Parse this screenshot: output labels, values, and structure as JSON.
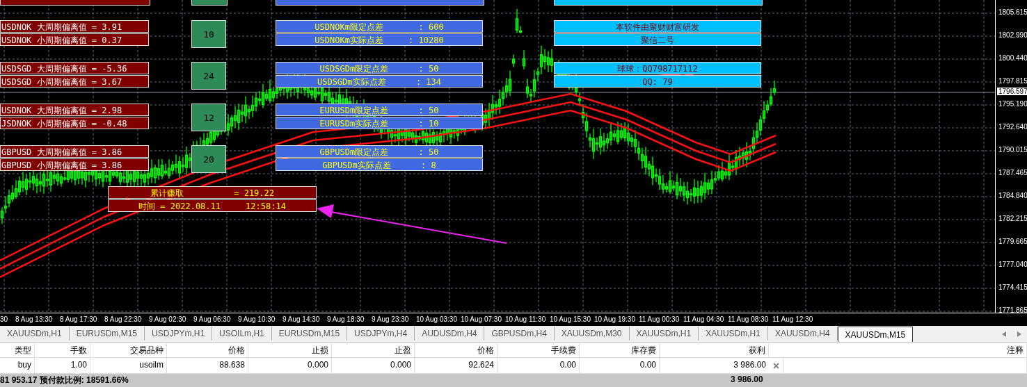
{
  "monitor_groups": [
    {
      "deviation": [
        "USDNOK 大周期偏离值 = 3.91",
        "USDNOK 小周期偏离值 = 0.37"
      ],
      "count": "10",
      "spread": [
        "USDNOKm限定点差       : 600",
        "USDNOKm实际点差     : 10280"
      ]
    },
    {
      "deviation": [
        "USDSGD 大周期偏离值 = -5.36",
        "USDSGD 小周期偏离值 = 3.67"
      ],
      "count": "24",
      "spread": [
        "USDSGDm限定点差      : 50",
        "USDSGDm实际点差      : 134"
      ]
    },
    {
      "deviation": [
        "USDNOK 大周期偏离值 = 2.98",
        "JSDNOK 小周期偏离值 = -0.48"
      ],
      "count": "12",
      "spread": [
        "EURUSDm限定点差      : 50",
        "EURUSDm实际点差      : 10"
      ]
    },
    {
      "deviation": [
        "GBPUSD 大周期偏离值 = 3.86",
        "GBPUSD 小周期偏离值 = 3.86"
      ],
      "count": "20",
      "spread": [
        "GBPUSDm限定点差      : 50",
        "GBPUSDm实际点差      : 8"
      ]
    }
  ],
  "info_lines": [
    "本软件由聚财财富研发",
    "聚信二号",
    "球球：QQ798717112",
    "QQ: 79"
  ],
  "profit_panel": [
    "累计赚取          = 219.22",
    "时间 = 2022.08.11     12:58:14"
  ],
  "price_axis": {
    "labels": [
      "1805.615",
      "1802.990",
      "1800.440",
      "1797.815",
      "1795.190",
      "1792.640",
      "1790.015",
      "1787.465",
      "1784.840",
      "1782.215",
      "1779.665",
      "1777.040",
      "1774.415",
      "1771.865"
    ],
    "current_price": "1796.597"
  },
  "time_axis": [
    "30",
    "8 Aug 13:30",
    "8 Aug 17:30",
    "8 Aug 22:30",
    "9 Aug 02:30",
    "9 Aug 06:30",
    "9 Aug 10:30",
    "9 Aug 14:30",
    "9 Aug 18:30",
    "9 Aug 23:30",
    "10 Aug 03:30",
    "10 Aug 07:30",
    "10 Aug 11:30",
    "10 Aug 15:30",
    "10 Aug 19:30",
    "11 Aug 00:30",
    "11 Aug 04:30",
    "11 Aug 08:30",
    "11 Aug 12:30"
  ],
  "chart_tabs": [
    {
      "label": "XAUUSDm,H1",
      "selected": false
    },
    {
      "label": "EURUSDm,M15",
      "selected": false
    },
    {
      "label": "USDJPYm,H1",
      "selected": false
    },
    {
      "label": "USOILm,H1",
      "selected": false
    },
    {
      "label": "EURUSDm,M15",
      "selected": false
    },
    {
      "label": "USDJPYm,H4",
      "selected": false
    },
    {
      "label": "AUDUSDm,H4",
      "selected": false
    },
    {
      "label": "GBPUSDm,H4",
      "selected": false
    },
    {
      "label": "XAUUSDm,M30",
      "selected": false
    },
    {
      "label": "XAUUSDm,H1",
      "selected": false
    },
    {
      "label": "XAUUSDm,H1",
      "selected": false
    },
    {
      "label": "XAUUSDm,H4",
      "selected": false
    },
    {
      "label": "XAUUSDm,M15",
      "selected": true
    }
  ],
  "trade_table": {
    "columns": [
      "类型",
      "手数",
      "交易品种",
      "价格",
      "止损",
      "止盈",
      "价格",
      "手续费",
      "库存费",
      "获利",
      "注释"
    ],
    "rows": [
      [
        "buy",
        "1.00",
        "usoilm",
        "88.638",
        "0.000",
        "0.000",
        "92.624",
        "0.00",
        "0.00",
        "3 986.00",
        ""
      ]
    ],
    "footer_balance": "81 953.17  预付款比例: 18591.66%",
    "footer_profit": "3 986.00"
  }
}
